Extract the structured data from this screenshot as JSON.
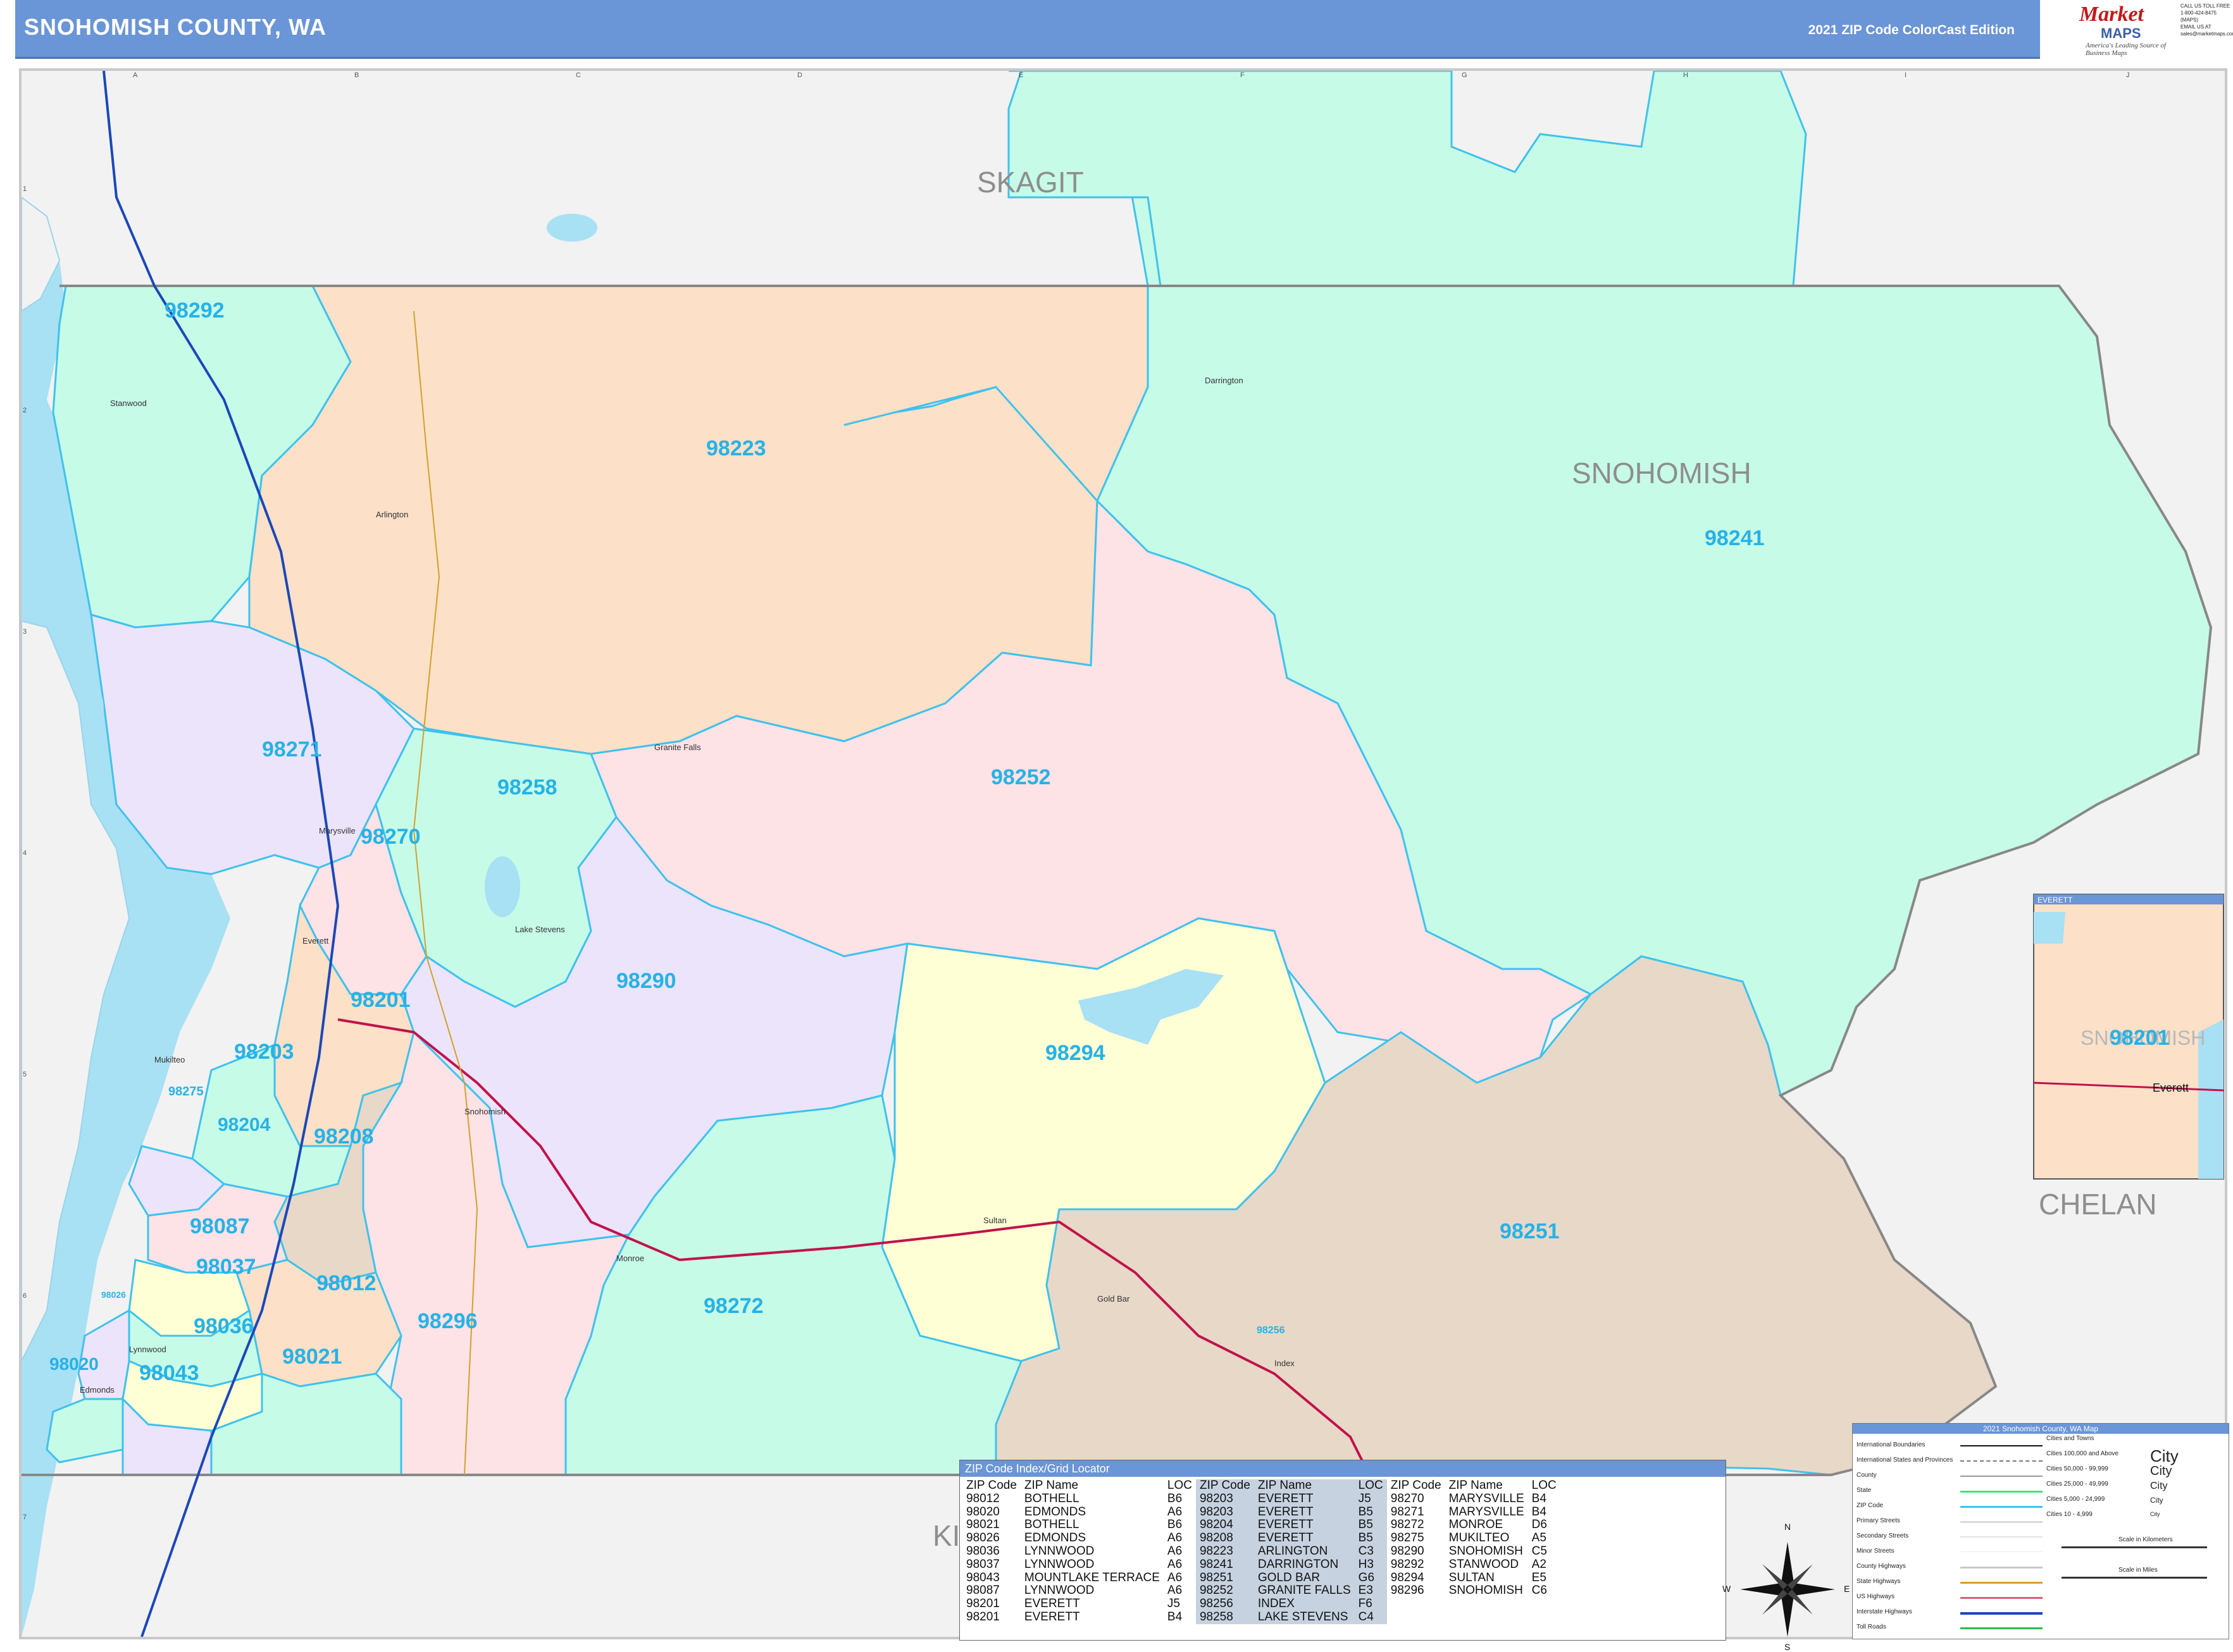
{
  "header": {
    "title": "SNOHOMISH COUNTY, WA",
    "edition": "2021 ZIP Code ColorCast Edition",
    "logo_top": "Market",
    "logo_bottom": "MAPS",
    "logo_tagline": "America's Leading Source of Business Maps",
    "contact_lines": [
      "CALL US TOLL FREE",
      "1-800-424-8475 (MAPS)",
      "EMAIL US AT",
      "sales@marketmaps.com"
    ]
  },
  "map": {
    "counties": [
      "SKAGIT",
      "SNOHOMISH",
      "CHELAN",
      "KI"
    ],
    "zip_labels": [
      "98292",
      "98223",
      "98241",
      "98271",
      "98258",
      "98252",
      "98270",
      "98290",
      "98201",
      "98294",
      "98203",
      "98275",
      "98204",
      "98208",
      "98087",
      "98037",
      "98012",
      "98251",
      "98272",
      "98296",
      "98036",
      "98020",
      "98043",
      "98021",
      "98026",
      "98256"
    ],
    "grid_letters": [
      "A",
      "B",
      "C",
      "D",
      "E",
      "F",
      "G",
      "H",
      "I",
      "J"
    ],
    "grid_numbers": [
      "1",
      "2",
      "3",
      "4",
      "5",
      "6",
      "7"
    ],
    "towns": [
      "Marysville",
      "Arlington",
      "Everett",
      "Lynnwood",
      "Edmonds",
      "Mukilteo",
      "Snohomish",
      "Monroe",
      "Sultan",
      "Granite Falls",
      "Darrington",
      "Index",
      "Gold Bar",
      "Lake Stevens",
      "Stanwood"
    ],
    "inset_title": "EVERETT",
    "inset_zip": "98201",
    "inset_county": "SNOHOMISH",
    "inset_city": "Everett"
  },
  "zip_index": {
    "title": "ZIP Code Index/Grid Locator",
    "headers": [
      "ZIP Code",
      "ZIP Name",
      "LOC"
    ],
    "col1": [
      [
        "98012",
        "BOTHELL",
        "B6"
      ],
      [
        "98020",
        "EDMONDS",
        "A6"
      ],
      [
        "98021",
        "BOTHELL",
        "B6"
      ],
      [
        "98026",
        "EDMONDS",
        "A6"
      ],
      [
        "98036",
        "LYNNWOOD",
        "A6"
      ],
      [
        "98037",
        "LYNNWOOD",
        "A6"
      ],
      [
        "98043",
        "MOUNTLAKE TERRACE",
        "A6"
      ],
      [
        "98087",
        "LYNNWOOD",
        "A6"
      ],
      [
        "98201",
        "EVERETT",
        "J5"
      ],
      [
        "98201",
        "EVERETT",
        "B4"
      ]
    ],
    "col2": [
      [
        "98203",
        "EVERETT",
        "J5"
      ],
      [
        "98203",
        "EVERETT",
        "B5"
      ],
      [
        "98204",
        "EVERETT",
        "B5"
      ],
      [
        "98208",
        "EVERETT",
        "B5"
      ],
      [
        "98223",
        "ARLINGTON",
        "C3"
      ],
      [
        "98241",
        "DARRINGTON",
        "H3"
      ],
      [
        "98251",
        "GOLD BAR",
        "G6"
      ],
      [
        "98252",
        "GRANITE FALLS",
        "E3"
      ],
      [
        "98256",
        "INDEX",
        "F6"
      ],
      [
        "98258",
        "LAKE STEVENS",
        "C4"
      ]
    ],
    "col3": [
      [
        "98270",
        "MARYSVILLE",
        "B4"
      ],
      [
        "98271",
        "MARYSVILLE",
        "B4"
      ],
      [
        "98272",
        "MONROE",
        "D6"
      ],
      [
        "98275",
        "MUKILTEO",
        "A5"
      ],
      [
        "98290",
        "SNOHOMISH",
        "C5"
      ],
      [
        "98292",
        "STANWOOD",
        "A2"
      ],
      [
        "98294",
        "SULTAN",
        "E5"
      ],
      [
        "98296",
        "SNOHOMISH",
        "C6"
      ]
    ]
  },
  "legend": {
    "title": "2021 Snohomish County, WA Map",
    "items": [
      "International Boundaries",
      "International States and Provinces",
      "County",
      "State",
      "ZIP Code",
      "Primary Streets",
      "Secondary Streets",
      "Minor Streets",
      "County Highways",
      "State Highways",
      "US Highways",
      "Interstate Highways",
      "Toll Roads"
    ],
    "cities_header": "Cities and Towns",
    "pop": [
      "Cities 100,000 and Above",
      "Cities 50,000 - 99,999",
      "Cities 25,000 - 49,999",
      "Cities 5,000 - 24,999",
      "Cities 10 - 4,999"
    ],
    "pop_samples": [
      "City",
      "City",
      "City",
      "City",
      "City"
    ],
    "scale_km": "Scale in Kilometers",
    "scale_mi": "Scale in Miles"
  },
  "compass": {
    "n": "N",
    "s": "S",
    "e": "E",
    "w": "W"
  },
  "colors": {
    "header": "#6a95d6",
    "water": "#a8e0f4",
    "outside": "#f2f2f2",
    "zip_label": "#27b2e6",
    "mint": "#c6fbe8",
    "peach": "#fde0c8",
    "pink": "#fde2e6",
    "lavender": "#ece4fb",
    "yellow": "#ffffd6",
    "tan": "#e8d8c8"
  }
}
